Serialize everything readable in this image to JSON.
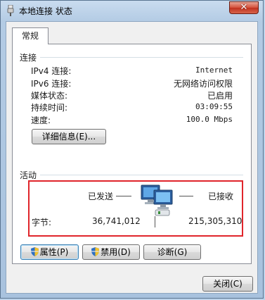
{
  "window": {
    "title": "本地连接 状态",
    "close_glyph": "✕"
  },
  "tabs": [
    {
      "label": "常规"
    }
  ],
  "connection": {
    "section_label": "连接",
    "rows": [
      {
        "label": "IPv4 连接:",
        "value": "Internet"
      },
      {
        "label": "IPv6 连接:",
        "value": "无网络访问权限"
      },
      {
        "label": "媒体状态:",
        "value": "已启用"
      },
      {
        "label": "持续时间:",
        "value": "03:09:55"
      },
      {
        "label": "速度:",
        "value": "100.0 Mbps"
      }
    ],
    "details_button": "详细信息(E)..."
  },
  "activity": {
    "section_label": "活动",
    "sent_label": "已发送",
    "received_label": "已接收",
    "bytes_label": "字节:",
    "bytes_sent": "36,741,012",
    "bytes_received": "215,305,310"
  },
  "buttons": {
    "properties": "属性(P)",
    "disable": "禁用(D)",
    "diagnose": "诊断(G)",
    "close": "关闭(C)"
  },
  "icons": {
    "title": "network-adapter-icon",
    "activity": "network-computers-icon",
    "uac": "uac-shield-icon"
  },
  "colors": {
    "highlight_box": "#e0252b",
    "close_button": "#c0321f"
  }
}
